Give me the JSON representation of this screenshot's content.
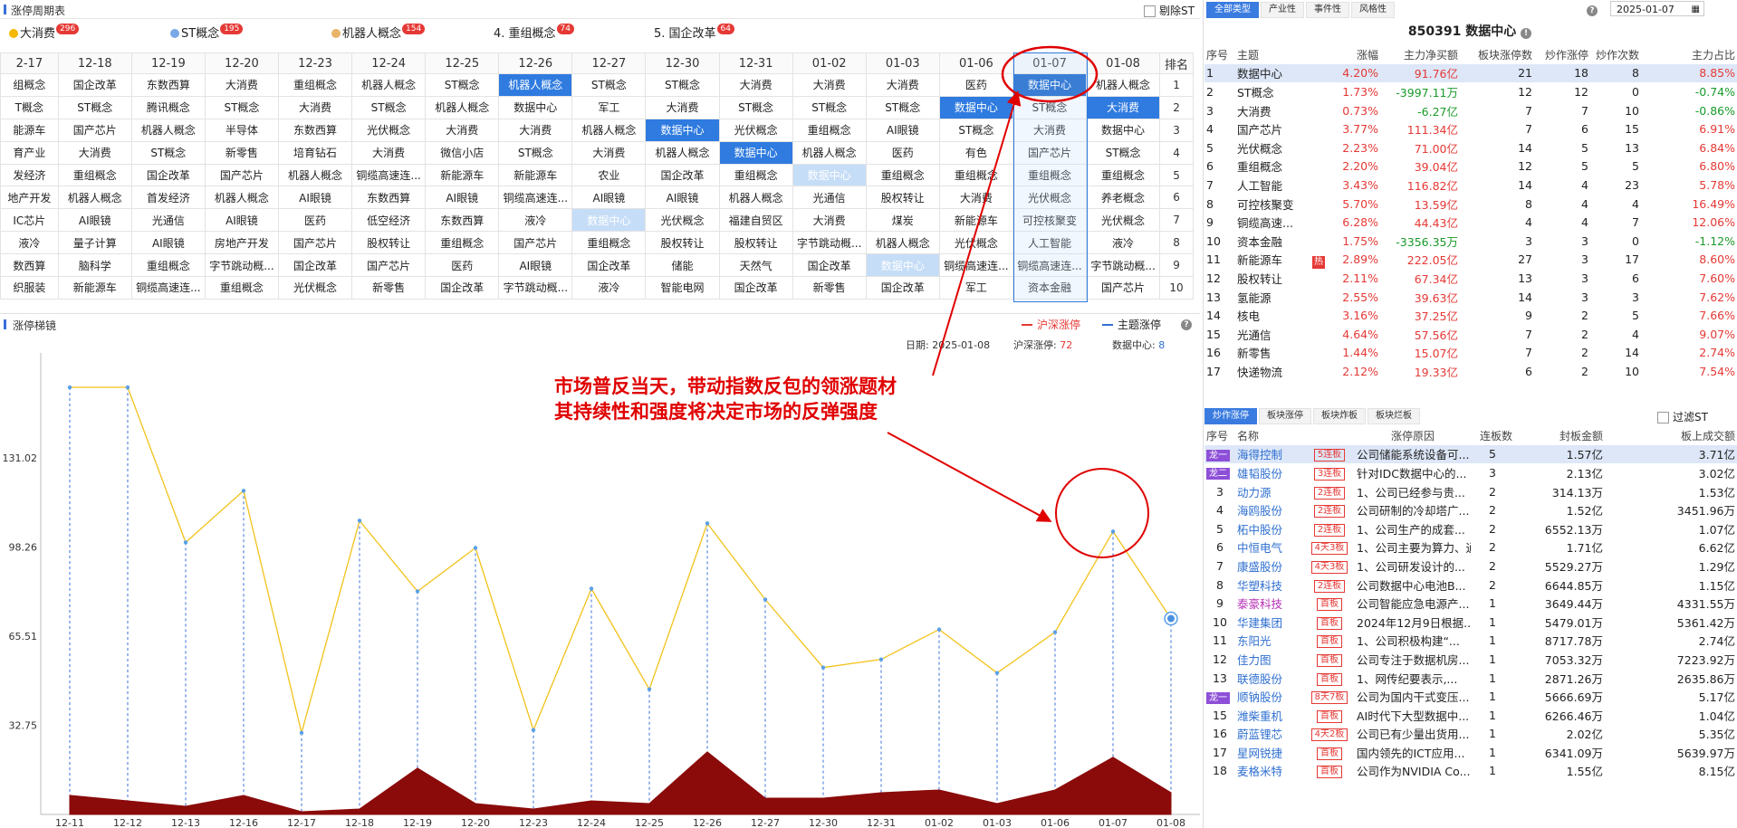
{
  "header": {
    "title": "涨停周期表",
    "exclude_st": "剔除ST"
  },
  "concepts": [
    {
      "name": "大消费",
      "count": "296",
      "color": "#f5b800"
    },
    {
      "name": "ST概念",
      "count": "195",
      "color": "#7aa7e8"
    },
    {
      "name": "机器人概念",
      "count": "154",
      "color": "#e8b46a"
    },
    {
      "name": "4. 重组概念",
      "count": "74",
      "color": ""
    },
    {
      "name": "5. 国企改革",
      "count": "64",
      "color": ""
    }
  ],
  "grid": {
    "dates": [
      "2-17",
      "12-18",
      "12-19",
      "12-20",
      "12-23",
      "12-24",
      "12-25",
      "12-26",
      "12-27",
      "12-30",
      "12-31",
      "01-02",
      "01-03",
      "01-06",
      "01-07",
      "01-08"
    ],
    "rank_label": "排名",
    "rows": [
      {
        "rank": "1",
        "cells": [
          "组概念",
          "国企改革",
          "东数西算",
          "大消费",
          "重组概念",
          "机器人概念",
          "ST概念",
          "机器人概念",
          "ST概念",
          "ST概念",
          "大消费",
          "大消费",
          "大消费",
          "医药",
          "数据中心",
          "机器人概念"
        ]
      },
      {
        "rank": "2",
        "cells": [
          "T概念",
          "ST概念",
          "腾讯概念",
          "ST概念",
          "大消费",
          "ST概念",
          "机器人概念",
          "数据中心",
          "军工",
          "大消费",
          "ST概念",
          "ST概念",
          "ST概念",
          "数据中心",
          "ST概念",
          "大消费"
        ]
      },
      {
        "rank": "3",
        "cells": [
          "能源车",
          "国产芯片",
          "机器人概念",
          "半导体",
          "东数西算",
          "光伏概念",
          "大消费",
          "大消费",
          "机器人概念",
          "数据中心",
          "光伏概念",
          "重组概念",
          "AI眼镜",
          "ST概念",
          "大消费",
          "数据中心"
        ]
      },
      {
        "rank": "4",
        "cells": [
          "育产业",
          "大消费",
          "ST概念",
          "新零售",
          "培育钻石",
          "大消费",
          "微信小店",
          "ST概念",
          "大消费",
          "机器人概念",
          "数据中心",
          "机器人概念",
          "医药",
          "有色",
          "国产芯片",
          "ST概念"
        ]
      },
      {
        "rank": "5",
        "cells": [
          "发经济",
          "重组概念",
          "国企改革",
          "国产芯片",
          "机器人概念",
          "铜缆高速连...",
          "新能源车",
          "新能源车",
          "农业",
          "国企改革",
          "重组概念",
          "数据中心",
          "重组概念",
          "重组概念",
          "重组概念",
          "重组概念"
        ]
      },
      {
        "rank": "6",
        "cells": [
          "地产开发",
          "机器人概念",
          "首发经济",
          "机器人概念",
          "AI眼镜",
          "东数西算",
          "AI眼镜",
          "铜缆高速连...",
          "AI眼镜",
          "AI眼镜",
          "机器人概念",
          "光通信",
          "股权转让",
          "大消费",
          "光伏概念",
          "养老概念"
        ]
      },
      {
        "rank": "7",
        "cells": [
          "IC芯片",
          "AI眼镜",
          "光通信",
          "AI眼镜",
          "医药",
          "低空经济",
          "东数西算",
          "液冷",
          "数据中心",
          "光伏概念",
          "福建自贸区",
          "大消费",
          "煤炭",
          "新能源车",
          "可控核聚变",
          "光伏概念"
        ]
      },
      {
        "rank": "8",
        "cells": [
          "液冷",
          "量子计算",
          "AI眼镜",
          "房地产开发",
          "国产芯片",
          "股权转让",
          "重组概念",
          "国产芯片",
          "重组概念",
          "股权转让",
          "股权转让",
          "字节跳动概...",
          "机器人概念",
          "光伏概念",
          "人工智能",
          "液冷"
        ]
      },
      {
        "rank": "9",
        "cells": [
          "数西算",
          "脑科学",
          "重组概念",
          "字节跳动概...",
          "国企改革",
          "国产芯片",
          "医药",
          "AI眼镜",
          "国企改革",
          "储能",
          "天然气",
          "国企改革",
          "数据中心",
          "铜缆高速连...",
          "铜缆高速连...",
          "字节跳动概..."
        ]
      },
      {
        "rank": "10",
        "cells": [
          "织服装",
          "新能源车",
          "铜缆高速连...",
          "重组概念",
          "光伏概念",
          "新零售",
          "国企改革",
          "字节跳动概...",
          "液冷",
          "智能电网",
          "国企改革",
          "新零售",
          "国企改革",
          "军工",
          "资本金融",
          "国产芯片"
        ]
      }
    ]
  },
  "chart": {
    "title": "涨停梯镜",
    "legend_sh": "沪深涨停",
    "legend_theme": "主题涨停",
    "info_date_label": "日期:",
    "info_date": "2025-01-08",
    "info_sh_label": "沪深涨停:",
    "info_sh": "72",
    "info_theme_label": "数据中心:",
    "info_theme": "8",
    "annotation_line1": "市场普反当天，带动指数反包的领涨题材",
    "annotation_line2": "其持续性和强度将决定市场的反弹强度"
  },
  "chart_data": {
    "type": "line",
    "x": [
      "12-11",
      "12-12",
      "12-13",
      "12-16",
      "12-17",
      "12-18",
      "12-19",
      "12-20",
      "12-23",
      "12-24",
      "12-25",
      "12-26",
      "12-27",
      "12-30",
      "12-31",
      "01-02",
      "01-03",
      "01-06",
      "01-07",
      "01-08"
    ],
    "y_ticks": [
      32.75,
      65.51,
      98.26,
      131.02
    ],
    "ylim": [
      0,
      163
    ],
    "series": [
      {
        "name": "沪深涨停",
        "color": "#f2c21a",
        "values": [
          157,
          157,
          100,
          119,
          30,
          108,
          82,
          98,
          31,
          83,
          46,
          107,
          79,
          54,
          57,
          68,
          52,
          67,
          104,
          72
        ]
      },
      {
        "name": "主题涨停",
        "color": "#8b0a0a",
        "values": [
          7,
          5,
          3,
          7,
          1,
          2,
          17,
          4,
          2,
          5,
          4,
          23,
          6,
          6,
          8,
          9,
          4,
          9,
          21,
          8
        ]
      }
    ]
  },
  "right": {
    "tabs": [
      "全部类型",
      "产业性",
      "事件性",
      "风格性"
    ],
    "date": "2025-01-07",
    "stock_code": "850391 数据中心",
    "sector_headers": [
      "序号",
      "主题",
      "涨幅",
      "主力净买额",
      "板块涨停数",
      "炒作涨停",
      "炒作次数",
      "主力占比"
    ],
    "sectors": [
      [
        "1",
        "数据中心",
        "4.20%",
        "91.76亿",
        "21",
        "18",
        "8",
        "8.85%"
      ],
      [
        "2",
        "ST概念",
        "1.73%",
        "-3997.11万",
        "12",
        "12",
        "0",
        "-0.74%"
      ],
      [
        "3",
        "大消费",
        "0.73%",
        "-6.27亿",
        "7",
        "7",
        "10",
        "-0.86%"
      ],
      [
        "4",
        "国产芯片",
        "3.77%",
        "111.34亿",
        "7",
        "6",
        "15",
        "6.91%"
      ],
      [
        "5",
        "光伏概念",
        "2.23%",
        "71.00亿",
        "14",
        "5",
        "13",
        "6.84%"
      ],
      [
        "6",
        "重组概念",
        "2.20%",
        "39.04亿",
        "12",
        "5",
        "5",
        "6.80%"
      ],
      [
        "7",
        "人工智能",
        "3.43%",
        "116.82亿",
        "14",
        "4",
        "23",
        "5.78%"
      ],
      [
        "8",
        "可控核聚变",
        "5.70%",
        "13.59亿",
        "8",
        "4",
        "4",
        "16.49%"
      ],
      [
        "9",
        "铜缆高速...",
        "6.28%",
        "44.43亿",
        "4",
        "4",
        "7",
        "12.06%"
      ],
      [
        "10",
        "资本金融",
        "1.75%",
        "-3356.35万",
        "3",
        "3",
        "0",
        "-1.12%"
      ],
      [
        "11",
        "新能源车",
        "2.89%",
        "222.05亿",
        "27",
        "3",
        "17",
        "8.60%"
      ],
      [
        "12",
        "股权转让",
        "2.11%",
        "67.34亿",
        "13",
        "3",
        "6",
        "7.60%"
      ],
      [
        "13",
        "氢能源",
        "2.55%",
        "39.63亿",
        "14",
        "3",
        "3",
        "7.62%"
      ],
      [
        "14",
        "核电",
        "3.16%",
        "37.25亿",
        "9",
        "2",
        "5",
        "7.66%"
      ],
      [
        "15",
        "光通信",
        "4.64%",
        "57.56亿",
        "7",
        "2",
        "4",
        "9.07%"
      ],
      [
        "16",
        "新零售",
        "1.44%",
        "15.07亿",
        "7",
        "2",
        "14",
        "2.74%"
      ],
      [
        "17",
        "快递物流",
        "2.12%",
        "19.33亿",
        "6",
        "2",
        "10",
        "7.54%"
      ]
    ],
    "hot_label": "热",
    "tabs2": [
      "炒作涨停",
      "板块涨停",
      "板块炸板",
      "板块烂板"
    ],
    "filter_st": "过滤ST",
    "stock_headers": [
      "序号",
      "名称",
      "涨停原因",
      "连板数",
      "封板金额",
      "板上成交额"
    ],
    "stocks": [
      [
        "龙一",
        "海得控制",
        "5连板",
        "公司储能系统设备可...",
        "5",
        "1.57亿",
        "3.71亿"
      ],
      [
        "龙二",
        "雄韬股份",
        "3连板",
        "针对IDC数据中心的...",
        "3",
        "2.13亿",
        "3.02亿"
      ],
      [
        "3",
        "动力源",
        "2连板",
        "1、公司已经参与贵...",
        "2",
        "314.13万",
        "1.53亿"
      ],
      [
        "4",
        "海鸥股份",
        "2连板",
        "公司研制的冷却塔广...",
        "2",
        "1.52亿",
        "3451.96万"
      ],
      [
        "5",
        "柘中股份",
        "2连板",
        "1、公司生产的成套...",
        "2",
        "6552.13万",
        "1.07亿"
      ],
      [
        "6",
        "中恒电气",
        "4天3板",
        "1、公司主要为算力、通...",
        "2",
        "1.71亿",
        "6.62亿"
      ],
      [
        "7",
        "康盛股份",
        "4天3板",
        "1、公司研发设计的...",
        "2",
        "5529.27万",
        "1.29亿"
      ],
      [
        "8",
        "华塑科技",
        "2连板",
        "公司数据中心电池B...",
        "2",
        "6644.85万",
        "1.15亿"
      ],
      [
        "9",
        "泰豪科技",
        "首板",
        "公司智能应急电源产...",
        "1",
        "3649.44万",
        "4331.55万"
      ],
      [
        "10",
        "华建集团",
        "首板",
        "2024年12月9日根据...",
        "1",
        "5479.01万",
        "5361.42万"
      ],
      [
        "11",
        "东阳光",
        "首板",
        "1、公司积极构建“...",
        "1",
        "8717.78万",
        "2.74亿"
      ],
      [
        "12",
        "佳力图",
        "首板",
        "公司专注于数据机房...",
        "1",
        "7053.32万",
        "7223.92万"
      ],
      [
        "13",
        "联德股份",
        "首板",
        "1、网传纪要表示,...",
        "1",
        "2871.26万",
        "2635.86万"
      ],
      [
        "龙一",
        "顺钠股份",
        "8天7板",
        "公司为国内干式变压...",
        "1",
        "5666.69万",
        "5.17亿"
      ],
      [
        "15",
        "潍柴重机",
        "首板",
        "AI时代下大型数据中...",
        "1",
        "6266.46万",
        "1.04亿"
      ],
      [
        "16",
        "蔚蓝锂芯",
        "4天2板",
        "公司已有少量出货用...",
        "1",
        "2.02亿",
        "5.35亿"
      ],
      [
        "17",
        "星网锐捷",
        "首板",
        "国内领先的ICT应用...",
        "1",
        "6341.09万",
        "5639.97万"
      ],
      [
        "18",
        "麦格米特",
        "首板",
        "公司作为NVIDIA Co...",
        "1",
        "1.55亿",
        "8.15亿"
      ]
    ]
  }
}
